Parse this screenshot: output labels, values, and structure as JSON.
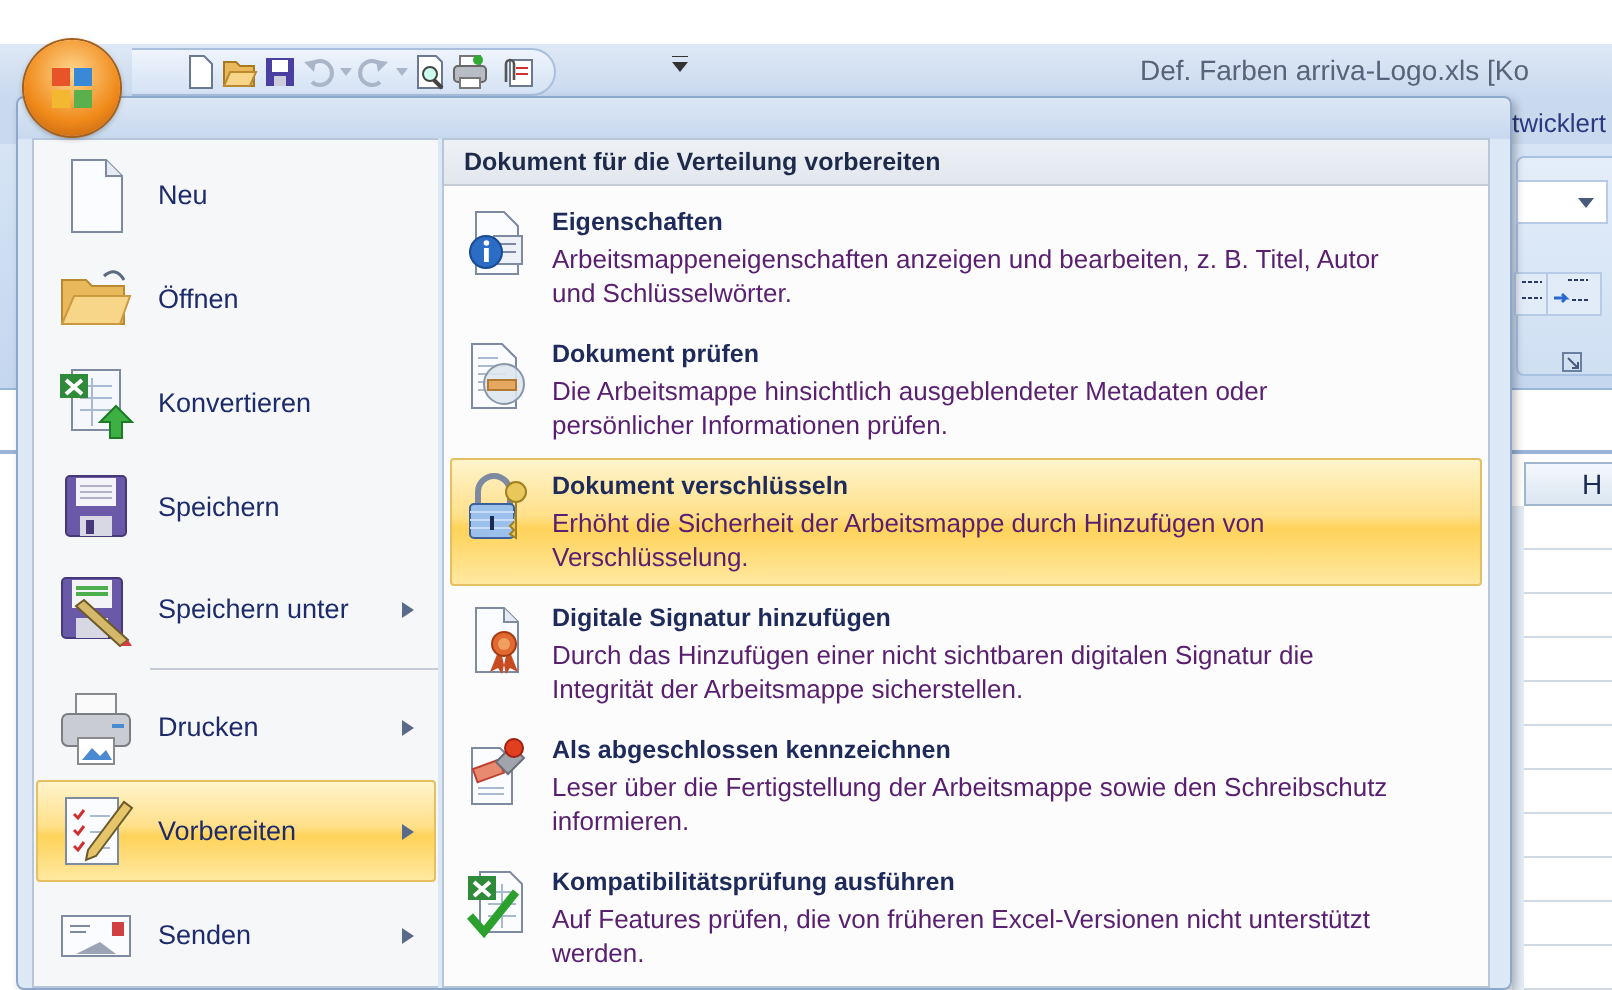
{
  "window": {
    "title": "Def. Farben arriva-Logo.xls  [Ko"
  },
  "ribbon": {
    "tab_fragment": "twicklert"
  },
  "sheet": {
    "column_header": "H"
  },
  "office_menu": {
    "items": [
      {
        "label": "Neu",
        "submenu": false,
        "separator_before": false,
        "selected": false
      },
      {
        "label": "Öffnen",
        "submenu": false,
        "separator_before": false,
        "selected": false
      },
      {
        "label": "Konvertieren",
        "submenu": false,
        "separator_before": false,
        "selected": false
      },
      {
        "label": "Speichern",
        "submenu": false,
        "separator_before": false,
        "selected": false
      },
      {
        "label": "Speichern unter",
        "submenu": true,
        "separator_before": false,
        "selected": false
      },
      {
        "label": "Drucken",
        "submenu": true,
        "separator_before": true,
        "selected": false
      },
      {
        "label": "Vorbereiten",
        "submenu": true,
        "separator_before": false,
        "selected": true
      },
      {
        "label": "Senden",
        "submenu": true,
        "separator_before": false,
        "selected": false
      }
    ],
    "submenu": {
      "title": "Dokument für die Verteilung vorbereiten",
      "items": [
        {
          "title": "Eigenschaften",
          "description": "Arbeitsmappeneigenschaften anzeigen und bearbeiten, z. B. Titel, Autor und Schlüsselwörter.",
          "selected": false
        },
        {
          "title": "Dokument prüfen",
          "description": "Die Arbeitsmappe hinsichtlich ausgeblendeter Metadaten oder persönlicher Informationen prüfen.",
          "selected": false
        },
        {
          "title": "Dokument verschlüsseln",
          "description": "Erhöht die Sicherheit der Arbeitsmappe durch Hinzufügen von Verschlüsselung.",
          "selected": true
        },
        {
          "title": "Digitale Signatur hinzufügen",
          "description": "Durch das Hinzufügen einer nicht sichtbaren digitalen Signatur die Integrität der Arbeitsmappe sicherstellen.",
          "selected": false
        },
        {
          "title": "Als abgeschlossen kennzeichnen",
          "description": "Leser über die Fertigstellung der Arbeitsmappe sowie den Schreibschutz informieren.",
          "selected": false
        },
        {
          "title": "Kompatibilitätsprüfung ausführen",
          "description": "Auf Features prüfen, die von früheren Excel-Versionen nicht unterstützt werden.",
          "selected": false
        }
      ]
    }
  }
}
